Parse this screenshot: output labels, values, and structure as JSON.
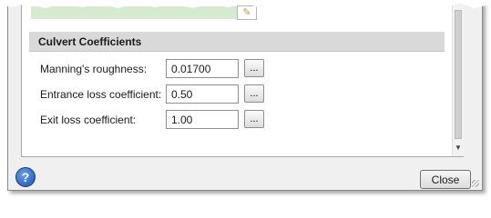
{
  "section": {
    "title": "Culvert Coefficients"
  },
  "fields": [
    {
      "label": "Manning's roughness:",
      "value": "0.01700",
      "button_label": "..."
    },
    {
      "label": "Entrance loss coefficient:",
      "value": "0.50",
      "button_label": "..."
    },
    {
      "label": "Exit loss coefficient:",
      "value": "1.00",
      "button_label": "..."
    }
  ],
  "footer": {
    "help_label": "?",
    "close_label": "Close"
  },
  "colors": {
    "header_bg": "#d9d9d9",
    "help_blue": "#1d4fae",
    "strip_green": "#d6ead0"
  },
  "icons": {
    "edit": "pencil-icon",
    "help": "help-icon",
    "scroll": "chevron-down-icon"
  }
}
